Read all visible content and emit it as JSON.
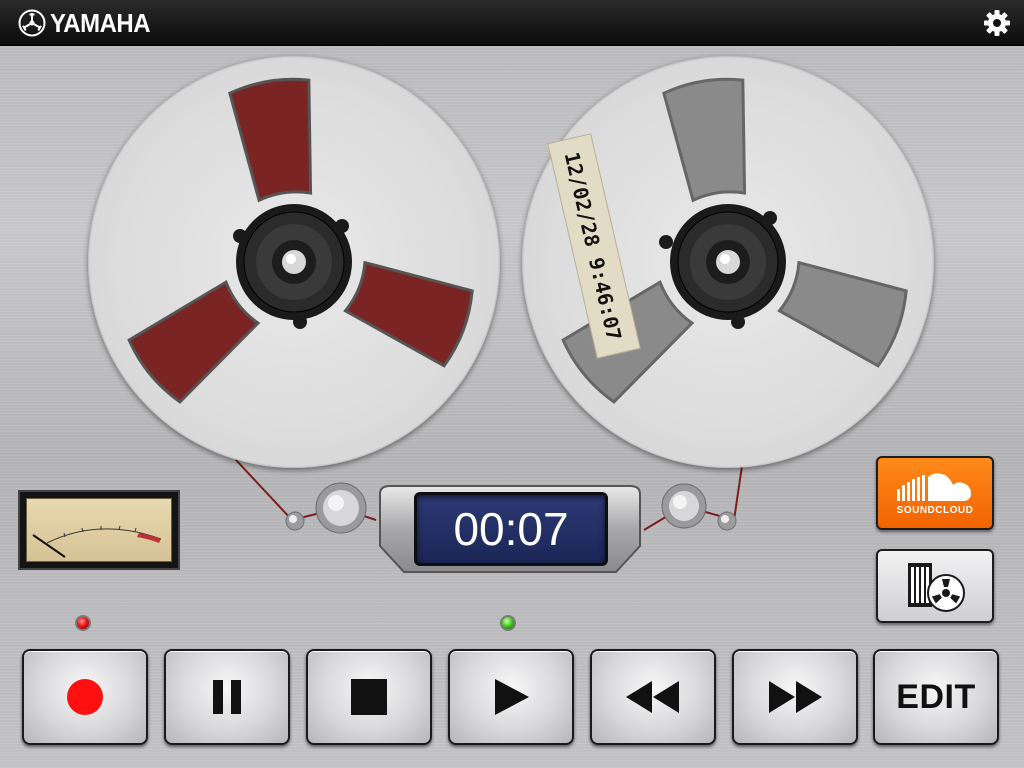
{
  "header": {
    "brand": "YAMAHA",
    "settings_icon": "gear-icon"
  },
  "reels": {
    "left": {
      "color": "#7a2424"
    },
    "right": {
      "color": "#8a8a8a",
      "tape_label": "12/02/28 9:46:07"
    }
  },
  "counter": {
    "time": "00:07"
  },
  "indicators": {
    "record_led_color": "#e01010",
    "play_led_color": "#41c41c"
  },
  "side_buttons": {
    "soundcloud": {
      "label": "SOUNDCLOUD",
      "color": "#f26300",
      "icon": "soundcloud-icon"
    },
    "library": {
      "icon": "tape-library-icon"
    }
  },
  "transport": {
    "record": {
      "icon": "record-icon"
    },
    "pause": {
      "icon": "pause-icon"
    },
    "stop": {
      "icon": "stop-icon"
    },
    "play": {
      "icon": "play-icon"
    },
    "rewind": {
      "icon": "rewind-icon"
    },
    "fast_forward": {
      "icon": "fast-forward-icon"
    },
    "edit": {
      "label": "EDIT"
    }
  }
}
